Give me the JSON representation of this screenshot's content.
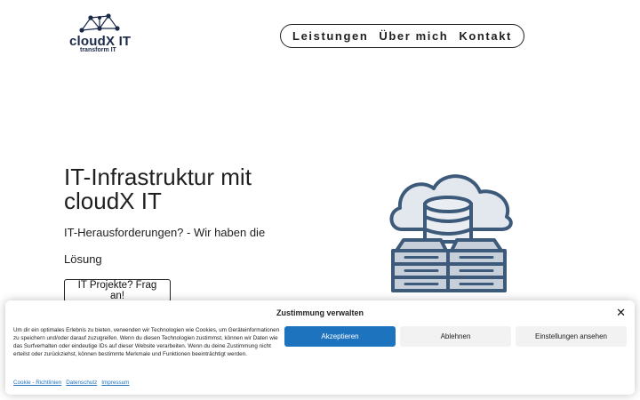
{
  "header": {
    "logo": {
      "name": "cloudX IT",
      "tagline": "transform IT"
    },
    "nav": [
      "Leistungen",
      "Über mich",
      "Kontakt"
    ]
  },
  "hero": {
    "title": "IT-Infrastruktur mit cloudX IT",
    "subtitle": "IT-Herausforderungen? - Wir haben die Lösung",
    "cta_label": "IT Projekte? Frag an!",
    "illustration_icon": "cloud-database-server-icon"
  },
  "cookie_banner": {
    "title": "Zustimmung verwalten",
    "text": "Um dir ein optimales Erlebnis zu bieten, verwenden wir Technologien wie Cookies, um Geräteinformationen zu speichern und/oder darauf zuzugreifen. Wenn du diesen Technologien zustimmst, können wir Daten wie das Surfverhalten oder eindeutige IDs auf dieser Website verarbeiten. Wenn du deine Zustimmung nicht erteilst oder zurückziehst, können bestimmte Merkmale und Funktionen beeinträchtigt werden.",
    "accept_label": "Akzeptieren",
    "deny_label": "Ablehnen",
    "settings_label": "Einstellungen ansehen",
    "links": [
      "Cookie - Richtlinien",
      "Datenschutz",
      "Impressum"
    ],
    "colors": {
      "accept_bg": "#1e73be",
      "link": "#1e73be"
    }
  }
}
